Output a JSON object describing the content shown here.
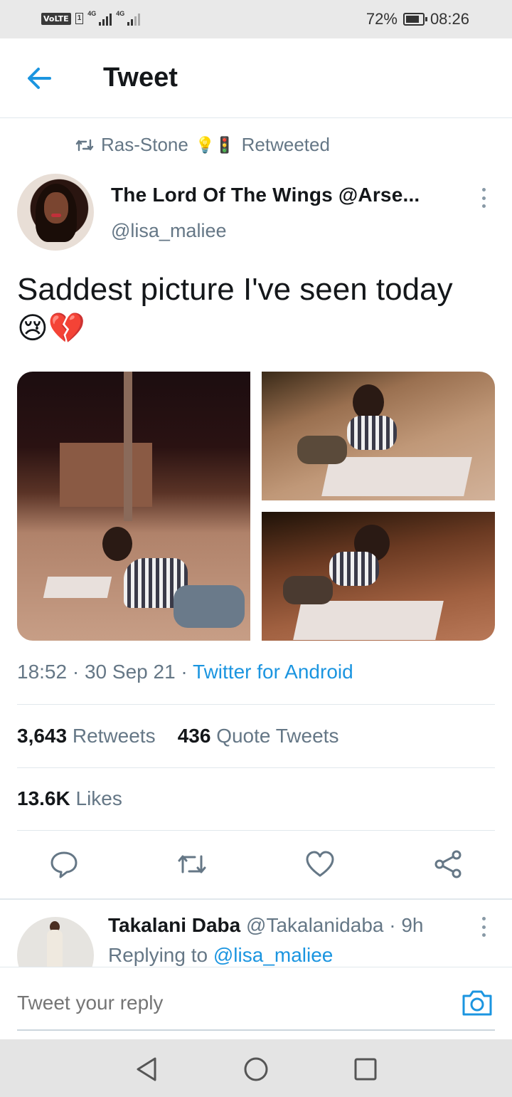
{
  "status_bar": {
    "volte": "VoLTE",
    "sim": "1",
    "net1": "4G",
    "net2": "4G",
    "battery": "72%",
    "time": "08:26"
  },
  "header": {
    "title": "Tweet",
    "back_icon": "arrow-left-icon"
  },
  "retweet": {
    "user": "Ras-Stone",
    "label": "Retweeted",
    "emoji": "💡🚦"
  },
  "tweet": {
    "author_name": "The Lord Of The Wings @Arse...",
    "author_handle": "@lisa_maliee",
    "text": "Saddest picture I've seen today",
    "emoji": "😢💔",
    "time": "18:52",
    "date": "30 Sep 21",
    "source": "Twitter for Android",
    "retweets_count": "3,643",
    "retweets_label": "Retweets",
    "quotes_count": "436",
    "quotes_label": "Quote Tweets",
    "likes_count": "13.6K",
    "likes_label": "Likes"
  },
  "reply": {
    "name": "Takalani Daba",
    "handle": "@Takalanidaba",
    "age": "9h",
    "replying_label": "Replying to",
    "replying_handle": "@lisa_maliee"
  },
  "composer": {
    "placeholder": "Tweet your reply"
  },
  "colors": {
    "accent": "#1b95e0",
    "secondary_text": "#657786",
    "primary_text": "#14171a"
  }
}
